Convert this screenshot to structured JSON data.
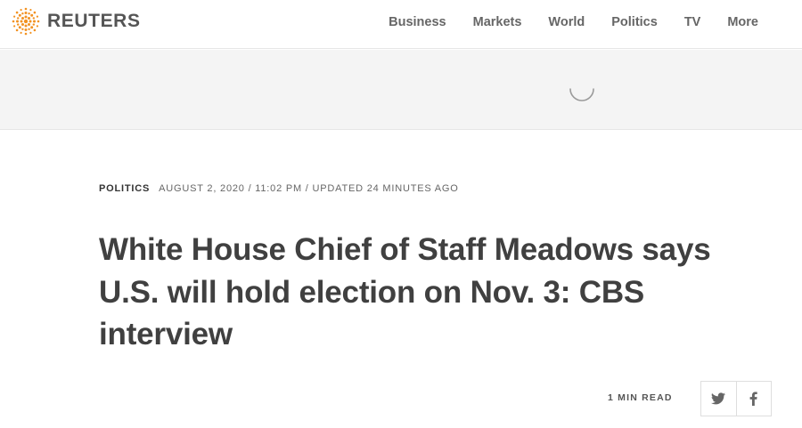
{
  "header": {
    "brand": "REUTERS",
    "nav": [
      "Business",
      "Markets",
      "World",
      "Politics",
      "TV",
      "More"
    ]
  },
  "article": {
    "section": "POLITICS",
    "dateline": "AUGUST 2, 2020 / 11:02 PM / UPDATED 24 MINUTES AGO",
    "headline": "White House Chief of Staff Meadows says U.S. will hold election on Nov. 3: CBS interview",
    "read_time": "1 MIN READ"
  },
  "share": {
    "icons": [
      "twitter-icon",
      "facebook-icon"
    ]
  },
  "colors": {
    "brand_orange": "#f29222",
    "text_dark": "#404040",
    "ad_background": "#f4f4f4"
  }
}
